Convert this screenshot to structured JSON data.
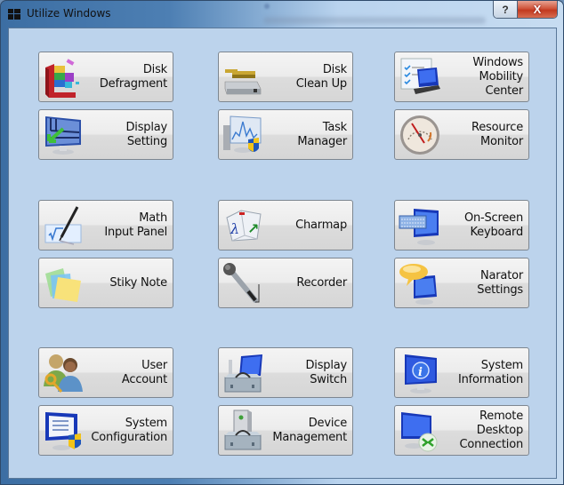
{
  "window": {
    "title": "Utilize Windows",
    "help_label": "?",
    "close_label": "X"
  },
  "tiles": [
    {
      "id": "disk-defragment",
      "icon": "disk-defragment-icon",
      "lines": [
        "Disk",
        "Defragment"
      ]
    },
    {
      "id": "disk-clean-up",
      "icon": "disk-cleanup-icon",
      "lines": [
        "Disk",
        "Clean Up"
      ]
    },
    {
      "id": "windows-mobility-center",
      "icon": "mobility-center-icon",
      "lines": [
        "Windows",
        "Mobility",
        "Center"
      ]
    },
    {
      "id": "display-setting",
      "icon": "display-setting-icon",
      "lines": [
        "Display",
        "Setting"
      ]
    },
    {
      "id": "task-manager",
      "icon": "task-manager-icon",
      "lines": [
        "Task",
        "Manager"
      ]
    },
    {
      "id": "resource-monitor",
      "icon": "resource-monitor-icon",
      "lines": [
        "Resource",
        "Monitor"
      ]
    },
    {
      "id": "math-input-panel",
      "icon": "math-input-panel-icon",
      "lines": [
        "Math",
        "Input Panel"
      ]
    },
    {
      "id": "charmap",
      "icon": "charmap-icon",
      "lines": [
        "Charmap"
      ]
    },
    {
      "id": "on-screen-keyboard",
      "icon": "on-screen-keyboard-icon",
      "lines": [
        "On-Screen",
        "Keyboard"
      ]
    },
    {
      "id": "stiky-note",
      "icon": "sticky-note-icon",
      "lines": [
        "Stiky Note"
      ]
    },
    {
      "id": "recorder",
      "icon": "microphone-icon",
      "lines": [
        "Recorder"
      ]
    },
    {
      "id": "narator-settings",
      "icon": "narrator-icon",
      "lines": [
        "Narator",
        "Settings"
      ]
    },
    {
      "id": "user-account",
      "icon": "user-account-icon",
      "lines": [
        "User",
        "Account"
      ]
    },
    {
      "id": "display-switch",
      "icon": "display-switch-icon",
      "lines": [
        "Display",
        "Switch"
      ]
    },
    {
      "id": "system-information",
      "icon": "system-information-icon",
      "lines": [
        "System",
        "Information"
      ]
    },
    {
      "id": "system-configuration",
      "icon": "system-configuration-icon",
      "lines": [
        "System",
        "Configuration"
      ]
    },
    {
      "id": "device-management",
      "icon": "device-management-icon",
      "lines": [
        "Device",
        "Management"
      ]
    },
    {
      "id": "remote-desktop-connection",
      "icon": "remote-desktop-icon",
      "lines": [
        "Remote",
        "Desktop",
        "Connection"
      ]
    }
  ]
}
